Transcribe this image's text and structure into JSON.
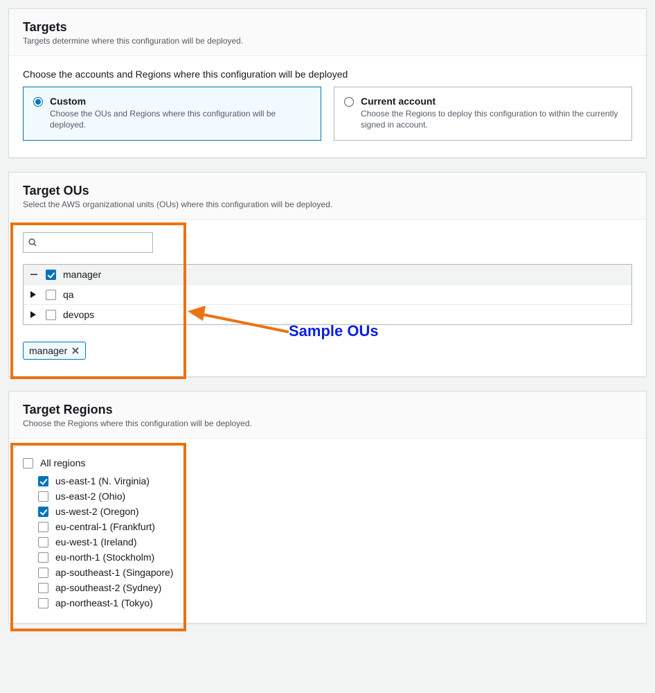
{
  "targets": {
    "title": "Targets",
    "desc": "Targets determine where this configuration will be deployed.",
    "chooseLabel": "Choose the accounts and Regions where this configuration will be deployed",
    "options": [
      {
        "title": "Custom",
        "desc": "Choose the OUs and Regions where this configuration will be deployed."
      },
      {
        "title": "Current account",
        "desc": "Choose the Regions to deploy this configuration to within the currently signed in account."
      }
    ]
  },
  "ous": {
    "title": "Target OUs",
    "desc": "Select the AWS organizational units (OUs) where this configuration will be deployed.",
    "searchPlaceholder": "",
    "tree": [
      {
        "label": "manager",
        "checked": true,
        "expandIcon": "dash"
      },
      {
        "label": "qa",
        "checked": false,
        "expandIcon": "caret"
      },
      {
        "label": "devops",
        "checked": false,
        "expandIcon": "caret"
      }
    ],
    "chip": "manager",
    "annotation": "Sample OUs"
  },
  "regions": {
    "title": "Target Regions",
    "desc": "Choose the Regions where this configuration will be deployed.",
    "allLabel": "All regions",
    "allChecked": false,
    "list": [
      {
        "label": "us-east-1 (N. Virginia)",
        "checked": true
      },
      {
        "label": "us-east-2 (Ohio)",
        "checked": false
      },
      {
        "label": "us-west-2 (Oregon)",
        "checked": true
      },
      {
        "label": "eu-central-1 (Frankfurt)",
        "checked": false
      },
      {
        "label": "eu-west-1 (Ireland)",
        "checked": false
      },
      {
        "label": "eu-north-1 (Stockholm)",
        "checked": false
      },
      {
        "label": "ap-southeast-1 (Singapore)",
        "checked": false
      },
      {
        "label": "ap-southeast-2 (Sydney)",
        "checked": false
      },
      {
        "label": "ap-northeast-1 (Tokyo)",
        "checked": false
      }
    ]
  }
}
